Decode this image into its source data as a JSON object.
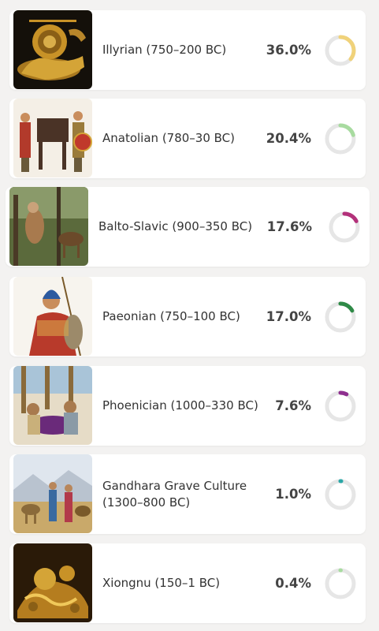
{
  "populations": [
    {
      "name": "Illyrian (750–200 BC)",
      "percent_label": "36.0%",
      "fraction": 0.36,
      "color": "#f0d27a",
      "image": "golden-warrior-on-horse-artifact"
    },
    {
      "name": "Anatolian (780–30 BC)",
      "percent_label": "20.4%",
      "fraction": 0.204,
      "color": "#a8dba0",
      "image": "ancient-warriors-with-horses"
    },
    {
      "name": "Balto-Slavic (900–350 BC)",
      "percent_label": "17.6%",
      "fraction": 0.176,
      "color": "#b3317a",
      "image": "hunters-in-forest-with-elk"
    },
    {
      "name": "Paeonian (750–100 BC)",
      "percent_label": "17.0%",
      "fraction": 0.17,
      "color": "#2f8a47",
      "image": "warrior-with-spear-and-shield"
    },
    {
      "name": "Phoenician (1000–330 BC)",
      "percent_label": "7.6%",
      "fraction": 0.076,
      "color": "#8e2f8f",
      "image": "dyers-at-harbor"
    },
    {
      "name": "Gandhara Grave Culture (1300–800 BC)",
      "percent_label": "1.0%",
      "fraction": 0.01,
      "color": "#2aa7a7",
      "image": "caravan-on-hills"
    },
    {
      "name": "Xiongnu (150–1 BC)",
      "percent_label": "0.4%",
      "fraction": 0.004,
      "color": "#a8dba0",
      "image": "golden-nomad-plaque"
    }
  ],
  "donut_track_color": "#e6e6e6"
}
